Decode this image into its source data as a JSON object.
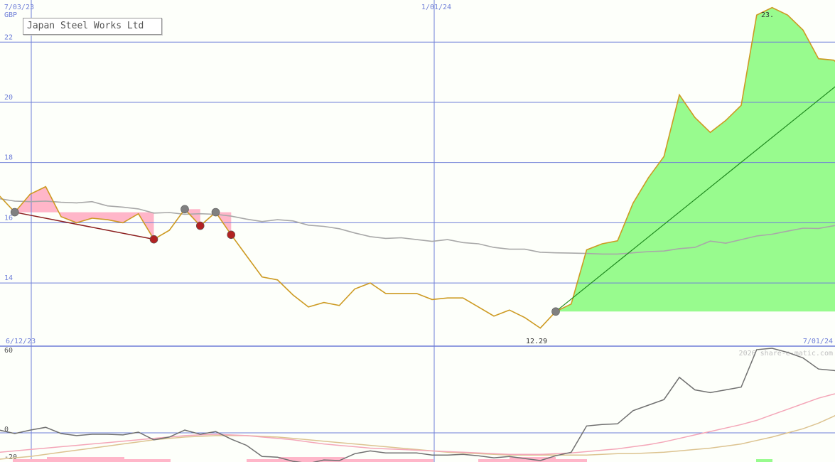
{
  "title": "Japan Steel Works Ltd",
  "currency": "GBP",
  "watermark": "2026 share-e-matic.com",
  "colors": {
    "background": "#fdfffa",
    "grid": "#6f7fd8",
    "price": "#cd9a22",
    "ma": "#a8a8a8",
    "gain_fill": "#98fb8e",
    "loss_fill": "#ffb6c9",
    "trend_up": "#1f8a1f",
    "trend_down": "#8b1e1e",
    "marker_grey": "#808080",
    "marker_red": "#b22222",
    "osc_line": "#707070",
    "osc_pink": "#f4a6b8",
    "osc_tan": "#dcc390"
  },
  "chart_data": [
    {
      "type": "line",
      "title": "Japan Steel Works Ltd",
      "ylabel": "GBP",
      "ylim": [
        11.9,
        23.4
      ],
      "yticks": [
        14,
        16,
        18,
        20,
        22
      ],
      "top_dates": [
        "7/03/23",
        "1/01/24"
      ],
      "bottom_dates": [
        "6/12/23",
        "7/01/24"
      ],
      "x": [
        "2023-06-12",
        "2023-06-19",
        "2023-06-26",
        "2023-07-03",
        "2023-07-10",
        "2023-07-17",
        "2023-07-24",
        "2023-07-31",
        "2023-08-07",
        "2023-08-14",
        "2023-08-21",
        "2023-08-28",
        "2023-09-04",
        "2023-09-11",
        "2023-09-18",
        "2023-09-25",
        "2023-10-02",
        "2023-10-09",
        "2023-10-16",
        "2023-10-23",
        "2023-10-30",
        "2023-11-06",
        "2023-11-13",
        "2023-11-20",
        "2023-11-27",
        "2023-12-04",
        "2023-12-11",
        "2023-12-18",
        "2023-12-25",
        "2024-01-01",
        "2024-01-08",
        "2024-01-15",
        "2024-01-22",
        "2024-01-29",
        "2024-02-05",
        "2024-02-12",
        "2024-02-19",
        "2024-02-26",
        "2024-03-04",
        "2024-03-11",
        "2024-03-18",
        "2024-03-25",
        "2024-04-01",
        "2024-04-08",
        "2024-04-15",
        "2024-04-22",
        "2024-04-29",
        "2024-05-06",
        "2024-05-13",
        "2024-05-20",
        "2024-05-27",
        "2024-06-03",
        "2024-06-10",
        "2024-06-17",
        "2024-06-24",
        "2024-07-01"
      ],
      "series": [
        {
          "name": "price",
          "values": [
            16.9,
            16.35,
            16.95,
            17.2,
            16.2,
            16.0,
            16.15,
            16.1,
            16.0,
            16.3,
            15.45,
            15.75,
            16.45,
            15.9,
            16.35,
            15.6,
            14.9,
            14.2,
            14.1,
            13.6,
            13.2,
            13.35,
            13.25,
            13.8,
            14.0,
            13.65,
            13.65,
            13.65,
            13.45,
            13.5,
            13.5,
            13.2,
            12.9,
            13.1,
            12.85,
            12.5,
            13.05,
            13.3,
            15.1,
            15.3,
            15.4,
            16.65,
            17.5,
            18.2,
            20.25,
            19.5,
            19.0,
            19.4,
            19.9,
            22.9,
            23.15,
            22.9,
            22.4,
            21.45,
            21.4,
            20.9
          ]
        },
        {
          "name": "average",
          "values": [
            16.8,
            16.72,
            16.7,
            16.72,
            16.68,
            16.66,
            16.7,
            16.56,
            16.52,
            16.46,
            16.32,
            16.34,
            16.28,
            16.3,
            16.28,
            16.22,
            16.12,
            16.04,
            16.1,
            16.06,
            15.92,
            15.88,
            15.8,
            15.66,
            15.54,
            15.48,
            15.5,
            15.44,
            15.38,
            15.44,
            15.34,
            15.3,
            15.18,
            15.12,
            15.12,
            15.02,
            15.0,
            14.99,
            14.98,
            14.96,
            14.96,
            15.0,
            15.04,
            15.06,
            15.14,
            15.18,
            15.39,
            15.32,
            15.44,
            15.56,
            15.62,
            15.72,
            15.82,
            15.81,
            15.9,
            16.0
          ]
        }
      ],
      "low_label": "12.29",
      "high_label": "23."
    },
    {
      "type": "line",
      "ylim": [
        -21,
        62
      ],
      "yticks": [
        -20,
        0,
        60
      ],
      "series": [
        {
          "name": "momentum",
          "values": [
            2,
            -0.5,
            2,
            4,
            -0.5,
            -2,
            -1,
            -1,
            -1.5,
            0.5,
            -5,
            -3,
            2,
            -1,
            1,
            -4.5,
            -9,
            -17,
            -17.5,
            -20.5,
            -22,
            -19.5,
            -20,
            -15,
            -13,
            -14.5,
            -14.5,
            -14.5,
            -16,
            -16,
            -15.5,
            -16.5,
            -18,
            -17,
            -18.5,
            -20,
            -16.5,
            -14,
            5,
            6,
            6.5,
            16,
            20,
            24,
            40,
            31,
            29,
            31,
            33,
            60,
            61,
            58,
            54,
            46,
            45,
            43
          ]
        },
        {
          "name": "signal",
          "values": [
            -14,
            -13,
            -12,
            -11,
            -10,
            -9,
            -8,
            -7,
            -6,
            -5,
            -4,
            -3,
            -2,
            -1.5,
            -1,
            -1.5,
            -2,
            -3,
            -4,
            -5,
            -6.5,
            -8,
            -9,
            -10,
            -11,
            -11.5,
            -12,
            -12.5,
            -13,
            -13.5,
            -14,
            -14.5,
            -15,
            -15.5,
            -15.5,
            -15.5,
            -15,
            -14.5,
            -13.5,
            -12.5,
            -11.5,
            -10,
            -8.5,
            -6.5,
            -4,
            -1.5,
            1,
            3.5,
            6,
            9,
            13,
            17,
            21,
            25,
            28,
            30
          ]
        },
        {
          "name": "slow",
          "values": [
            -19,
            -18,
            -17,
            -15.5,
            -14,
            -12.5,
            -11,
            -9.5,
            -8,
            -6.5,
            -5,
            -4,
            -3,
            -2.5,
            -2,
            -2,
            -2,
            -2.5,
            -3,
            -4,
            -5,
            -6,
            -7,
            -8,
            -9,
            -10,
            -11,
            -12,
            -13,
            -14,
            -14.5,
            -15,
            -15.5,
            -16,
            -16,
            -16,
            -16,
            -16,
            -16,
            -15.5,
            -15,
            -15,
            -14.5,
            -14,
            -13,
            -12,
            -11,
            -9.5,
            -8,
            -5.5,
            -3,
            0,
            3,
            7,
            12,
            19
          ]
        }
      ]
    }
  ]
}
